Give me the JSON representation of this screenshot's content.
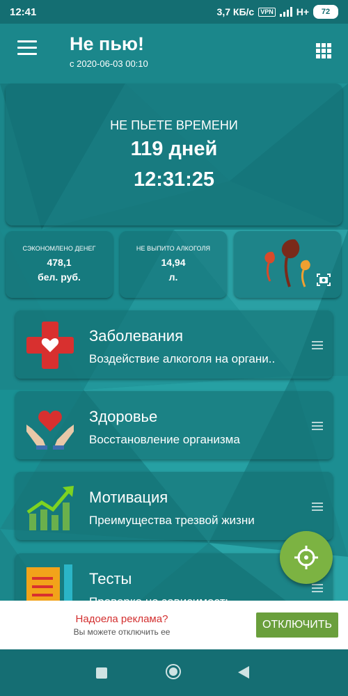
{
  "status_bar": {
    "time": "12:41",
    "network_speed": "3,7 КБ/с",
    "vpn": "VPN",
    "network_type": "H+",
    "battery": "72"
  },
  "app_bar": {
    "title": "Не пью!",
    "subtitle": "с 2020-06-03 00:10"
  },
  "timer": {
    "label": "НЕ ПЬЕТЕ ВРЕМЕНИ",
    "days": "119 дней",
    "clock": "12:31:25"
  },
  "stats": [
    {
      "label": "СЭКОНОМЛЕНО ДЕНЕГ",
      "value": "478,1",
      "unit": "бел. руб."
    },
    {
      "label": "НЕ ВЫПИТО АЛКОГОЛЯ",
      "value": "14,94",
      "unit": "л."
    }
  ],
  "cards": [
    {
      "title": "Заболевания",
      "desc": "Воздействие алкоголя на органи..",
      "icon": "medical-cross-heart-icon"
    },
    {
      "title": "Здоровье",
      "desc": "Восстановление организма",
      "icon": "hands-heart-icon"
    },
    {
      "title": "Мотивация",
      "desc": "Преимущества трезвой жизни",
      "icon": "growth-chart-icon"
    },
    {
      "title": "Тесты",
      "desc": "Проверка на зависимость",
      "icon": "notebook-icon"
    }
  ],
  "ad": {
    "title": "Надоела реклама?",
    "subtitle": "Вы можете отключить ее",
    "button": "ОТКЛЮЧИТЬ"
  },
  "colors": {
    "primary": "#1a8488",
    "fab": "#7cb342",
    "ad_button": "#6a9f3c",
    "ad_title": "#d32f2f"
  }
}
